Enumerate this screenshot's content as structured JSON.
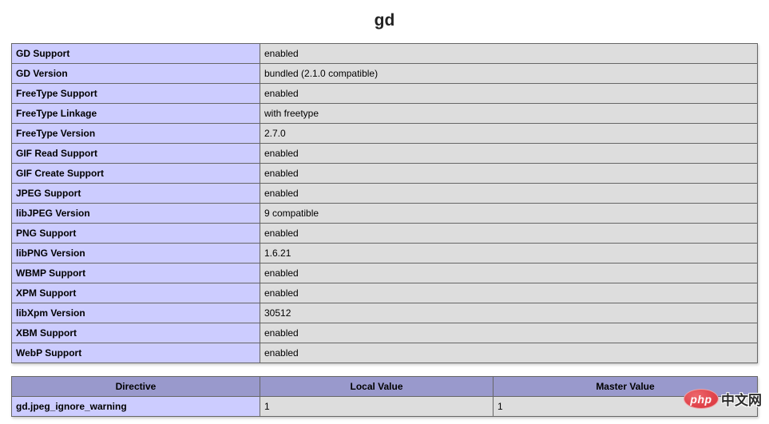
{
  "title": "gd",
  "info_table": {
    "rows": [
      {
        "label": "GD Support",
        "value": "enabled"
      },
      {
        "label": "GD Version",
        "value": "bundled (2.1.0 compatible)"
      },
      {
        "label": "FreeType Support",
        "value": "enabled"
      },
      {
        "label": "FreeType Linkage",
        "value": "with freetype"
      },
      {
        "label": "FreeType Version",
        "value": "2.7.0"
      },
      {
        "label": "GIF Read Support",
        "value": "enabled"
      },
      {
        "label": "GIF Create Support",
        "value": "enabled"
      },
      {
        "label": "JPEG Support",
        "value": "enabled"
      },
      {
        "label": "libJPEG Version",
        "value": "9 compatible"
      },
      {
        "label": "PNG Support",
        "value": "enabled"
      },
      {
        "label": "libPNG Version",
        "value": "1.6.21"
      },
      {
        "label": "WBMP Support",
        "value": "enabled"
      },
      {
        "label": "XPM Support",
        "value": "enabled"
      },
      {
        "label": "libXpm Version",
        "value": "30512"
      },
      {
        "label": "XBM Support",
        "value": "enabled"
      },
      {
        "label": "WebP Support",
        "value": "enabled"
      }
    ]
  },
  "directives_table": {
    "headers": [
      "Directive",
      "Local Value",
      "Master Value"
    ],
    "rows": [
      {
        "directive": "gd.jpeg_ignore_warning",
        "local_value": "1",
        "master_value": "1"
      }
    ]
  },
  "watermark": {
    "logo_text": "php",
    "site_text": "中文网"
  },
  "colors": {
    "header_bg": "#9999cc",
    "label_bg": "#ccccff",
    "value_bg": "#dddddd",
    "border": "#666666",
    "logo_red": "#e0434a"
  }
}
